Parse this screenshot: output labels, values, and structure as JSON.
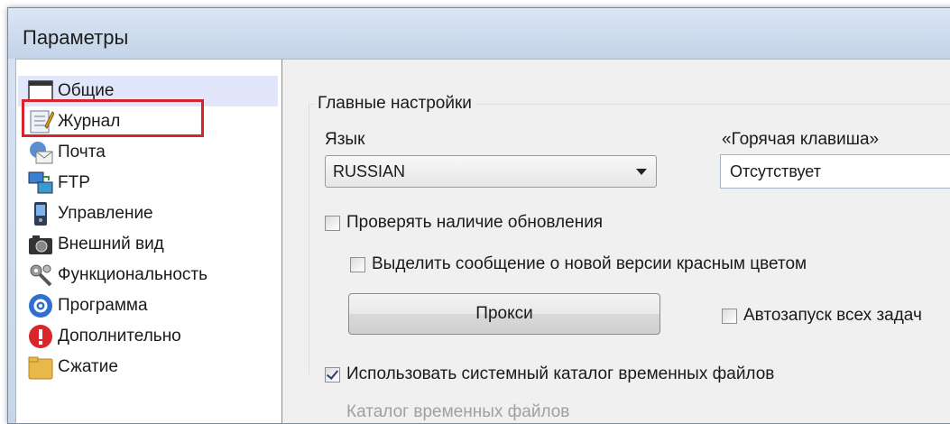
{
  "window": {
    "title": "Параметры"
  },
  "sidebar": {
    "items": [
      {
        "label": "Общие",
        "icon": "window-icon",
        "selected": true
      },
      {
        "label": "Журнал",
        "icon": "journal-icon"
      },
      {
        "label": "Почта",
        "icon": "mail-icon"
      },
      {
        "label": "FTP",
        "icon": "ftp-icon"
      },
      {
        "label": "Управление",
        "icon": "remote-icon"
      },
      {
        "label": "Внешний вид",
        "icon": "camera-icon"
      },
      {
        "label": "Функциональность",
        "icon": "tools-icon"
      },
      {
        "label": "Программа",
        "icon": "gear-icon"
      },
      {
        "label": "Дополнительно",
        "icon": "alert-icon"
      },
      {
        "label": "Сжатие",
        "icon": "folder-icon"
      }
    ]
  },
  "main": {
    "group_title": "Главные настройки",
    "language": {
      "label": "Язык",
      "value": "RUSSIAN"
    },
    "hotkey": {
      "label": "«Горячая клавиша»",
      "value": "Отсутствует"
    },
    "check_updates": {
      "label": "Проверять наличие обновления",
      "checked": false
    },
    "highlight_new_version": {
      "label": "Выделить сообщение о новой версии красным цветом",
      "checked": false
    },
    "proxy_button": "Прокси",
    "autostart": {
      "label": "Автозапуск всех задач",
      "checked": false
    },
    "use_system_temp": {
      "label": "Использовать системный каталог временных файлов",
      "checked": true
    },
    "temp_dir_label": "Каталог временных файлов"
  },
  "colors": {
    "highlight_border": "#d9232c",
    "selected_bg": "#e1e6fa"
  }
}
